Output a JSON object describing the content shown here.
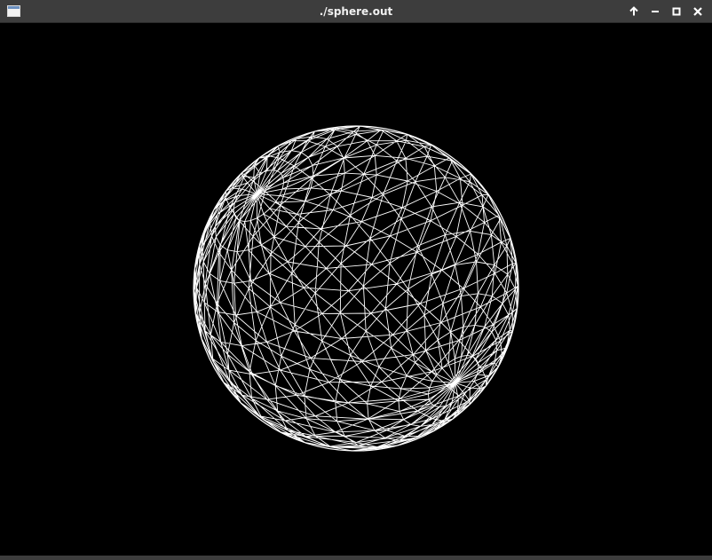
{
  "window": {
    "title": "./sphere.out",
    "controls": {
      "up": "arrow-up-icon",
      "minimize": "minimize-icon",
      "maximize": "maximize-icon",
      "close": "close-icon"
    }
  },
  "scene": {
    "background": "#000000",
    "wire_color": "#ffffff",
    "object": "sphere",
    "render_mode": "wireframe"
  }
}
